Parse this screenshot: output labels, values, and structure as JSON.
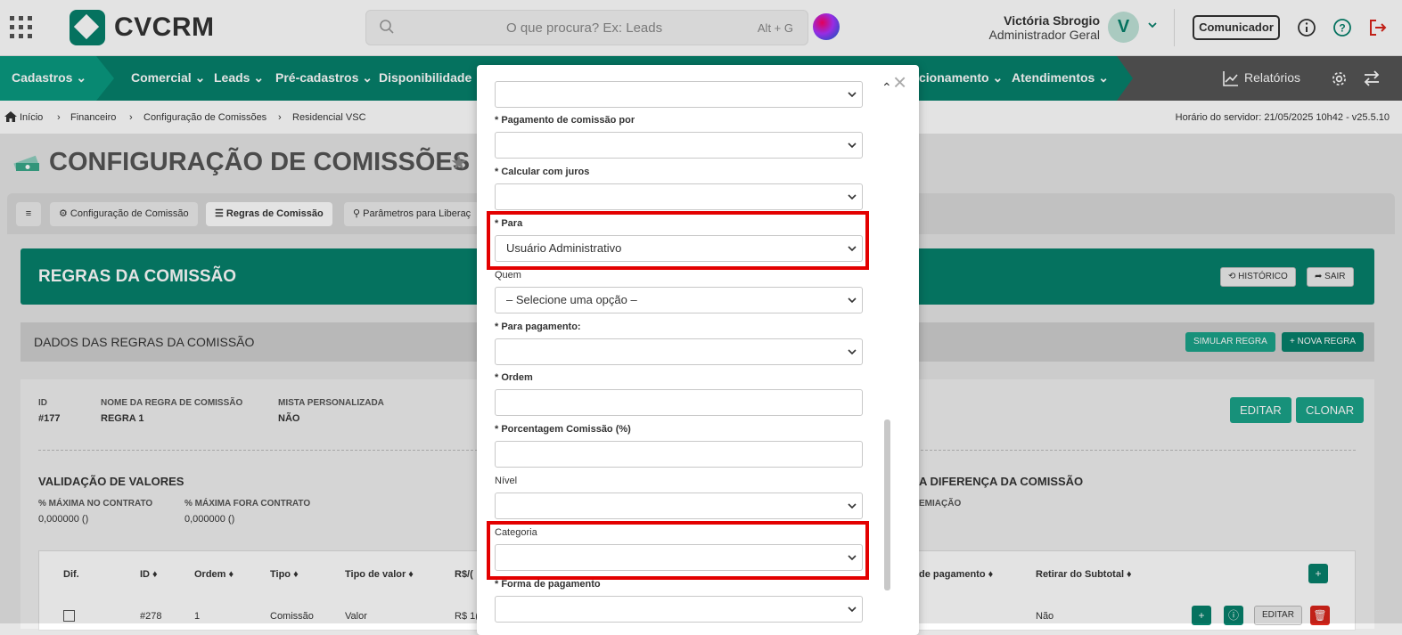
{
  "header": {
    "logo_text": "CVCRM",
    "search_placeholder": "O que procura? Ex: Leads",
    "search_shortcut": "Alt + G",
    "user_name": "Victória Sbrogio",
    "user_role": "Administrador Geral",
    "avatar_letter": "V",
    "comunicador_label": "Comunicador"
  },
  "nav": {
    "items": [
      "Cadastros",
      "Comercial",
      "Leads",
      "Pré-cadastros",
      "Disponibilidade",
      "cionamento",
      "Atendimentos"
    ],
    "relatorios": "Relatórios"
  },
  "breadcrumb": {
    "items": [
      "Início",
      "Financeiro",
      "Configuração de Comissões",
      "Residencial VSC"
    ],
    "server_time": "Horário do servidor: 21/05/2025 10h42 - v25.5.10"
  },
  "page": {
    "title": "CONFIGURAÇÃO DE COMISSÕES",
    "tabs": [
      "Configuração de Comissão",
      "Regras de Comissão",
      "Parâmetros para Liberaç"
    ],
    "banner_title": "REGRAS DA COMISSÃO",
    "historico": "HISTÓRICO",
    "sair": "SAIR",
    "section_title": "DADOS DAS REGRAS DA COMISSÃO",
    "simular": "SIMULAR REGRA",
    "nova": "+ NOVA REGRA",
    "info": {
      "id_label": "ID",
      "id_value": "#177",
      "nome_label": "NOME DA REGRA DE COMISSÃO",
      "nome_value": "REGRA 1",
      "mista_label": "MISTA PERSONALIZADA",
      "mista_value": "NÃO"
    },
    "editar": "EDITAR",
    "clonar": "CLONAR",
    "validacao_title": "VALIDAÇÃO DE VALORES",
    "max_contrato_label": "% MÁXIMA NO CONTRATO",
    "max_contrato_value": "0,000000 ()",
    "max_fora_label": "% MÁXIMA FORA CONTRATO",
    "max_fora_value": "0,000000 ()",
    "diferenca_title": "A DIFERENÇA DA COMISSÃO",
    "premiacao_label": "EMIAÇÃO",
    "table": {
      "headers": [
        "Dif.",
        "ID ♦",
        "Ordem ♦",
        "Tipo ♦",
        "Tipo de valor ♦",
        "R$/(",
        "de pagamento ♦",
        "Retirar do Subtotal ♦"
      ],
      "row": {
        "id": "#278",
        "ordem": "1",
        "tipo": "Comissão",
        "tipo_valor": "Valor",
        "rs": "R$ 1(",
        "retirar": "Não",
        "editar": "EDITAR"
      }
    }
  },
  "modal": {
    "fields": {
      "pagamento_por": {
        "label": "* Pagamento de comissão por",
        "value": ""
      },
      "calcular_juros": {
        "label": "* Calcular com juros",
        "value": ""
      },
      "para": {
        "label": "* Para",
        "value": "Usuário Administrativo"
      },
      "quem": {
        "label": "Quem",
        "value": "– Selecione uma opção –"
      },
      "para_pagamento": {
        "label": "* Para pagamento:",
        "value": ""
      },
      "ordem": {
        "label": "* Ordem",
        "value": ""
      },
      "porcentagem": {
        "label": "* Porcentagem Comissão (%)",
        "value": ""
      },
      "nivel": {
        "label": "Nível",
        "value": ""
      },
      "categoria": {
        "label": "Categoria",
        "value": ""
      },
      "forma_pagamento": {
        "label": "* Forma de pagamento",
        "value": ""
      }
    }
  },
  "colors": {
    "brand": "#06806b",
    "highlight": "#e30000"
  }
}
